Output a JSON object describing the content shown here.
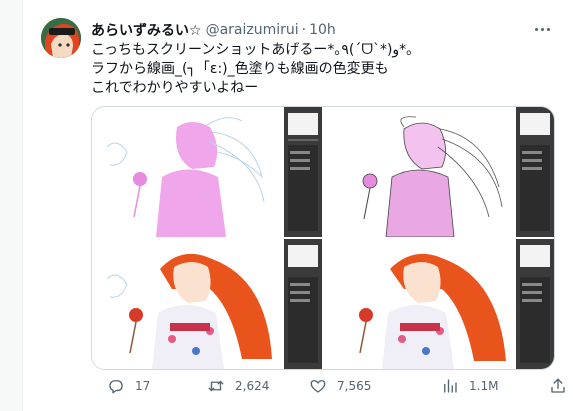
{
  "tweet": {
    "display_name": "あらいずみるい☆",
    "handle": "@araizumirui",
    "separator": "·",
    "time": "10h",
    "text": "こっちもスクリーンショットあげるー*｡٩(ˊᗜˋ*)و*｡\nラフから線画_(┐「ε:)_色塗りも線画の色変更も\nこれでわかりやすいよねー"
  },
  "actions": {
    "replies": "17",
    "retweets": "2,624",
    "likes": "7,565",
    "views": "1.1M"
  },
  "icons": {
    "more": "more-horizontal-icon",
    "reply": "reply-icon",
    "retweet": "retweet-icon",
    "like": "heart-icon",
    "views": "views-chart-icon",
    "share": "share-icon"
  },
  "colors": {
    "text_primary": "#0f1419",
    "text_secondary": "#536471",
    "border": "#cfd9de",
    "sketch_pink": "#e78be0",
    "hair_orange": "#e8541c",
    "app_dark": "#3b3b3b"
  }
}
